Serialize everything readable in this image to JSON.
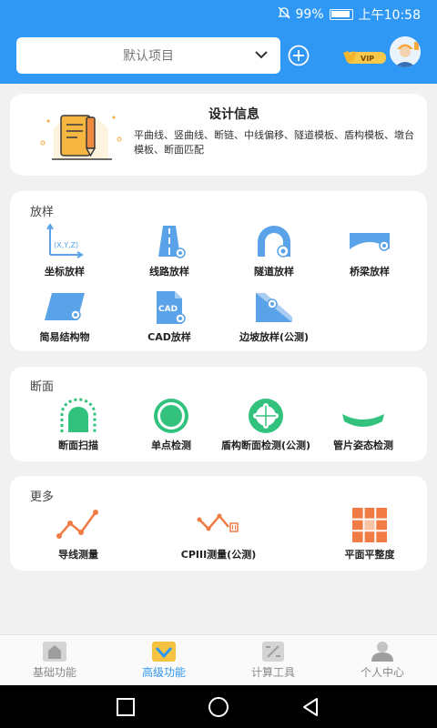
{
  "status_bar": {
    "battery": "99%",
    "time": "上午10:58"
  },
  "header": {
    "project_name": "默认项目",
    "vip_label": "VIP"
  },
  "design_info": {
    "title": "设计信息",
    "description": "平曲线、竖曲线、断链、中线偏移、隧道模板、盾构模板、墩台模板、断面匹配"
  },
  "sections": {
    "stakeout": {
      "title": "放样",
      "items": [
        "坐标放样",
        "线路放样",
        "隧道放样",
        "桥梁放样",
        "简易结构物",
        "CAD放样",
        "边坡放样(公测)"
      ]
    },
    "cross_section": {
      "title": "断面",
      "items": [
        "断面扫描",
        "单点检测",
        "盾构断面检测(公测)",
        "管片姿态检测"
      ]
    },
    "more": {
      "title": "更多",
      "items": [
        "导线测量",
        "CPIII测量(公测)",
        "平面平整度"
      ]
    }
  },
  "icon_text": {
    "coord": "(X,Y,Z)",
    "cad": "CAD"
  },
  "bottom_nav": {
    "items": [
      "基础功能",
      "高级功能",
      "计算工具",
      "个人中心"
    ],
    "active_index": 1
  },
  "colors": {
    "primary": "#2f97f4",
    "stakeout_blue": "#5aa3e8",
    "section_green": "#32c27e",
    "more_orange": "#f07b45"
  }
}
